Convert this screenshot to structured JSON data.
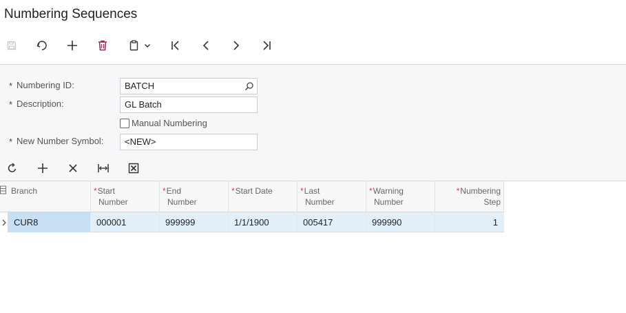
{
  "page": {
    "title": "Numbering Sequences"
  },
  "toolbar": {
    "buttons": [
      {
        "name": "save",
        "icon": "save-icon"
      },
      {
        "name": "undo",
        "icon": "undo-icon"
      },
      {
        "name": "add",
        "icon": "plus-icon"
      },
      {
        "name": "delete",
        "icon": "trash-icon"
      },
      {
        "name": "copy-paste",
        "icon": "clipboard-icon"
      },
      {
        "name": "first",
        "icon": "first-record-icon"
      },
      {
        "name": "previous",
        "icon": "previous-icon"
      },
      {
        "name": "next",
        "icon": "next-icon"
      },
      {
        "name": "last",
        "icon": "last-record-icon"
      }
    ]
  },
  "form": {
    "numbering_id": {
      "label": "Numbering ID:",
      "value": "BATCH",
      "required": "*"
    },
    "description": {
      "label": "Description:",
      "value": "GL Batch",
      "required": "*"
    },
    "manual_numbering": {
      "label": "Manual Numbering",
      "checked": false
    },
    "new_number_symbol": {
      "label": "New Number Symbol:",
      "value": "<NEW>",
      "required": "*"
    }
  },
  "grid_toolbar": {
    "buttons": [
      {
        "name": "refresh",
        "icon": "refresh-icon"
      },
      {
        "name": "add-row",
        "icon": "plus-icon"
      },
      {
        "name": "delete-row",
        "icon": "close-icon"
      },
      {
        "name": "fit-columns",
        "icon": "fit-width-icon"
      },
      {
        "name": "export-excel",
        "icon": "excel-icon"
      }
    ]
  },
  "grid": {
    "columns": [
      {
        "line1": "Branch",
        "line2": "",
        "required": ""
      },
      {
        "line1": "Start",
        "line2": "Number",
        "required": "*"
      },
      {
        "line1": "End",
        "line2": "Number",
        "required": "*"
      },
      {
        "line1": "Start Date",
        "line2": "",
        "required": "*"
      },
      {
        "line1": "Last",
        "line2": "Number",
        "required": "*"
      },
      {
        "line1": "Warning",
        "line2": "Number",
        "required": "*"
      },
      {
        "line1": "Numbering",
        "line2": "Step",
        "required": "*"
      }
    ],
    "rows": [
      [
        "CUR8",
        "000001",
        "999999",
        "1/1/1900",
        "005417",
        "999990",
        "1"
      ]
    ]
  },
  "colors": {
    "required_star": "#e0433c",
    "delete_icon": "#a3205a",
    "row_selected": "#e3f0fa",
    "active_cell": "#c8e0f4",
    "form_background": "#f6f7f9"
  }
}
